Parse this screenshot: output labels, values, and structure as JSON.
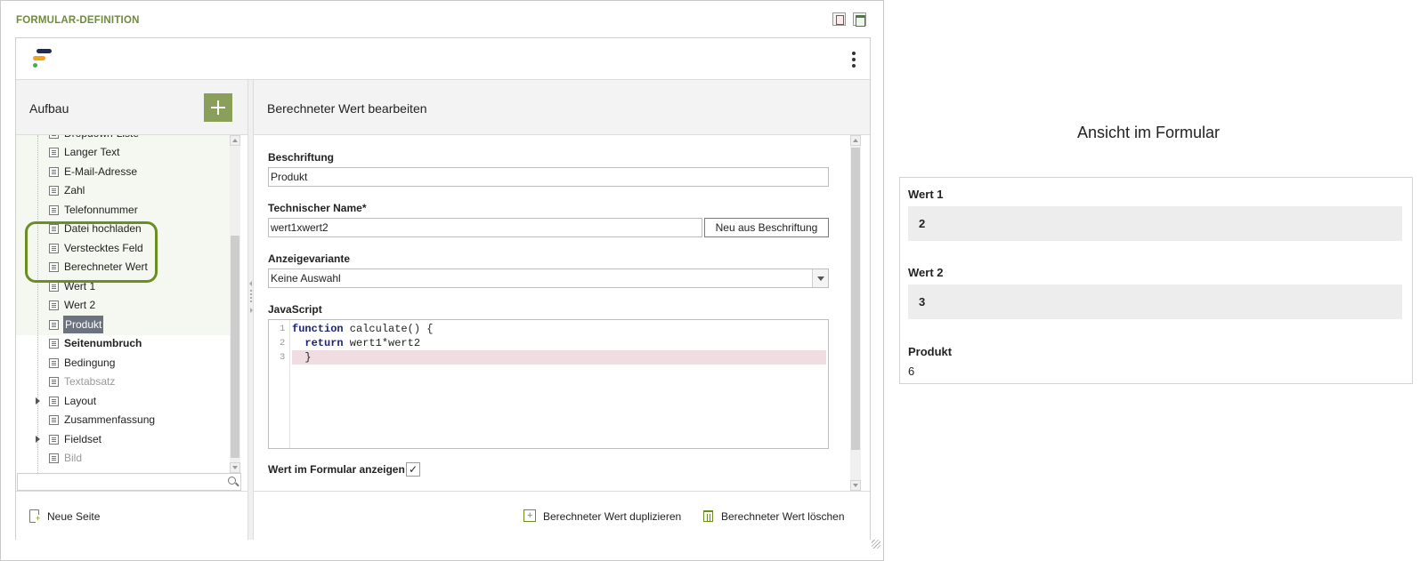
{
  "header": {
    "title": "FORMULAR-DEFINITION"
  },
  "left": {
    "title": "Aufbau",
    "tree": [
      {
        "label": "Dropdown-Liste",
        "style": "normal"
      },
      {
        "label": "Langer Text",
        "style": "normal"
      },
      {
        "label": "E-Mail-Adresse",
        "style": "normal"
      },
      {
        "label": "Zahl",
        "style": "normal"
      },
      {
        "label": "Telefonnummer",
        "style": "normal"
      },
      {
        "label": "Datei hochladen",
        "style": "normal"
      },
      {
        "label": "Verstecktes Feld",
        "style": "normal"
      },
      {
        "label": "Berechneter Wert",
        "style": "normal"
      },
      {
        "label": "Wert 1",
        "style": "normal"
      },
      {
        "label": "Wert 2",
        "style": "normal"
      },
      {
        "label": "Produkt",
        "style": "selected"
      },
      {
        "label": "Seitenumbruch",
        "style": "bold"
      },
      {
        "label": "Bedingung",
        "style": "normal"
      },
      {
        "label": "Textabsatz",
        "style": "grey"
      },
      {
        "label": "Layout",
        "style": "expandable"
      },
      {
        "label": "Zusammenfassung",
        "style": "normal"
      },
      {
        "label": "Fieldset",
        "style": "expandable"
      },
      {
        "label": "Bild",
        "style": "grey"
      }
    ],
    "search_placeholder": "",
    "new_page_label": "Neue Seite"
  },
  "right": {
    "title": "Berechneter Wert bearbeiten",
    "fields": {
      "caption_label": "Beschriftung",
      "caption_value": "Produkt",
      "tech_name_label": "Technischer Name*",
      "tech_name_value": "wert1xwert2",
      "regen_button": "Neu aus Beschriftung",
      "variant_label": "Anzeigevariante",
      "variant_value": "Keine Auswahl",
      "js_label": "JavaScript",
      "show_label": "Wert im Formular anzeigen",
      "show_checked": "✓"
    },
    "code_lines": [
      {
        "num": "1",
        "kw": "function",
        "rest": " calculate() {"
      },
      {
        "num": "2",
        "kw": "  return",
        "rest": " wert1*wert2"
      },
      {
        "num": "3",
        "kw": "",
        "rest": "  }"
      }
    ],
    "duplicate_label": "Berechneter Wert duplizieren",
    "delete_label": "Berechneter Wert löschen"
  },
  "preview": {
    "title": "Ansicht im Formular",
    "items": [
      {
        "label": "Wert 1",
        "value": "2"
      },
      {
        "label": "Wert 2",
        "value": "3"
      },
      {
        "label": "Produkt",
        "value": "6"
      }
    ]
  }
}
